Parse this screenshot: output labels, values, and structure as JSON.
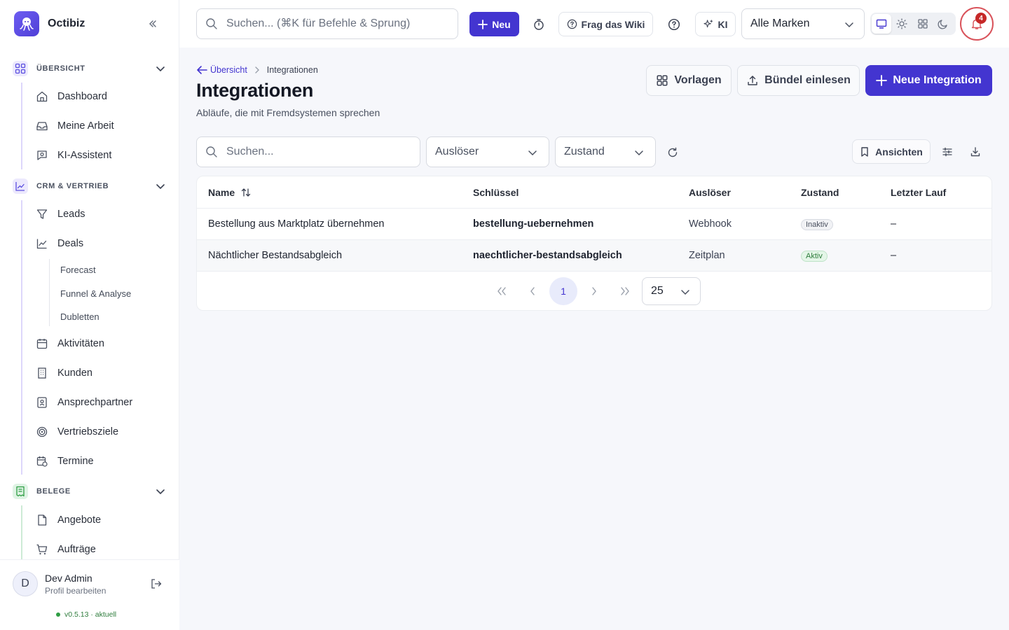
{
  "app": {
    "name": "Octibiz"
  },
  "sidebar": {
    "sections": [
      {
        "label": "ÜBERSICHT",
        "items": [
          "Dashboard",
          "Meine Arbeit",
          "KI-Assistent"
        ]
      },
      {
        "label": "CRM & VERTRIEB",
        "items": [
          "Leads",
          "Deals",
          "Aktivitäten",
          "Kunden",
          "Ansprechpartner",
          "Vertriebsziele",
          "Termine"
        ],
        "subitems": [
          "Forecast",
          "Funnel & Analyse",
          "Dubletten"
        ]
      },
      {
        "label": "BELEGE",
        "items": [
          "Angebote",
          "Aufträge"
        ]
      }
    ],
    "user": {
      "name": "Dev Admin",
      "sub": "Profil bearbeiten",
      "initial": "D"
    },
    "version": "v0.5.13 · aktuell"
  },
  "topbar": {
    "search_placeholder": "Suchen... (⌘K für Befehle & Sprung)",
    "new_label": "Neu",
    "wiki_label": "Frag das Wiki",
    "ki_label": "KI",
    "brand_select": "Alle Marken",
    "notification_count": "4"
  },
  "page": {
    "breadcrumb_back": "Übersicht",
    "breadcrumb_current": "Integrationen",
    "title": "Integrationen",
    "subtitle": "Abläufe, die mit Fremdsystemen sprechen",
    "btn_templates": "Vorlagen",
    "btn_import": "Bündel einlesen",
    "btn_new": "Neue Integration"
  },
  "filters": {
    "search_placeholder": "Suchen...",
    "trigger": "Auslöser",
    "state": "Zustand",
    "views": "Ansichten"
  },
  "table": {
    "headers": [
      "Name",
      "Schlüssel",
      "Auslöser",
      "Zustand",
      "Letzter Lauf"
    ],
    "rows": [
      {
        "name": "Bestellung aus Marktplatz übernehmen",
        "key": "bestellung-uebernehmen",
        "trigger": "Webhook",
        "state": "Inaktiv",
        "last_run": "–"
      },
      {
        "name": "Nächtlicher Bestandsabgleich",
        "key": "naechtlicher-bestandsabgleich",
        "trigger": "Zeitplan",
        "state": "Aktiv",
        "last_run": "–"
      }
    ]
  },
  "pagination": {
    "current_page": "1",
    "page_size": "25"
  },
  "colors": {
    "primary": "#4335d0",
    "active_badge": "#2f7d3d",
    "notification": "#c62828"
  }
}
